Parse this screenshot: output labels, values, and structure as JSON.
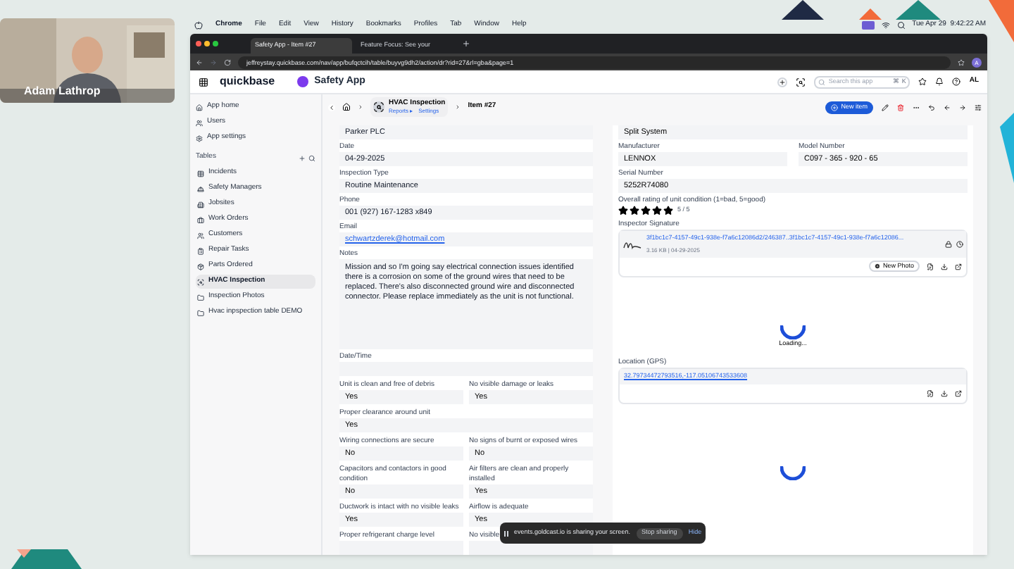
{
  "video_overlay": {
    "name": "Adam Lathrop"
  },
  "menu_bar": {
    "app": "Chrome",
    "items": [
      "File",
      "Edit",
      "View",
      "History",
      "Bookmarks",
      "Profiles",
      "Tab",
      "Window",
      "Help"
    ],
    "clock": "Tue Apr 29  9:42:22 AM"
  },
  "browser": {
    "tabs": [
      {
        "title": "Safety App - Item #27",
        "selected": true
      },
      {
        "title": "Feature Focus: See your",
        "selected": false
      }
    ],
    "url": "jeffreystay.quickbase.com/nav/app/bufqctcih/table/buyvg9dh2/action/dr?rid=27&rl=gba&page=1",
    "profile_initial": "A"
  },
  "app_header": {
    "logo": "quickbase",
    "app_name": "Safety App",
    "search": {
      "placeholder": "Search this app",
      "shortcut": "⌘ K"
    },
    "user_initials": "AL"
  },
  "sidebar": {
    "nav": [
      "App home",
      "Users",
      "App settings"
    ],
    "tables_heading": "Tables",
    "tables": [
      {
        "label": "Incidents",
        "selected": false
      },
      {
        "label": "Safety Managers",
        "selected": false
      },
      {
        "label": "Jobsites",
        "selected": false
      },
      {
        "label": "Work Orders",
        "selected": false
      },
      {
        "label": "Customers",
        "selected": false
      },
      {
        "label": "Repair Tasks",
        "selected": false
      },
      {
        "label": "Parts Ordered",
        "selected": false
      },
      {
        "label": "HVAC Inspection",
        "selected": true
      },
      {
        "label": "Inspection Photos",
        "selected": false
      },
      {
        "label": "Hvac inpspection table DEMO",
        "selected": false
      }
    ]
  },
  "breadcrumb": {
    "table": "HVAC Inspection",
    "links": [
      "Reports ▸",
      "Settings"
    ],
    "item": "Item #27",
    "new_button": "New item"
  },
  "left_fields": [
    {
      "kind": "text",
      "value": "Parker PLC"
    },
    {
      "kind": "text",
      "label": "Date",
      "value": "04-29-2025"
    },
    {
      "kind": "text",
      "label": "Inspection Type",
      "value": "Routine Maintenance"
    },
    {
      "kind": "text",
      "label": "Phone",
      "value": "001 (927) 167-1283 x849"
    },
    {
      "kind": "link",
      "label": "Email",
      "value": "schwartzderek@hotmail.com"
    },
    {
      "kind": "notes",
      "label": "Notes",
      "value": "Mission and so I'm going say electrical connection issues identified there is a corrosion on some of the ground wires that need to be replaced. There's also disconnected ground wire and disconnected connector. Please replace immediately as the unit is not functional."
    },
    {
      "kind": "text",
      "label": "Date/Time"
    }
  ],
  "checklist": [
    [
      {
        "label": "Unit is clean and free of debris",
        "value": "Yes"
      },
      {
        "label": "No visible damage or leaks",
        "value": "Yes"
      }
    ],
    [
      {
        "label": "Proper clearance around unit",
        "value": "Yes"
      }
    ],
    [
      {
        "label": "Wiring connections are secure",
        "value": "No"
      },
      {
        "label": "No signs of burnt or exposed wires",
        "value": "No"
      }
    ],
    [
      {
        "label": "Capacitors and contactors in good condition",
        "value": "No"
      },
      {
        "label": "Air filters are clean and properly installed",
        "value": "Yes"
      }
    ],
    [
      {
        "label": "Ductwork is intact with no visible leaks",
        "value": "Yes"
      },
      {
        "label": "Airflow is adequate",
        "value": "Yes"
      }
    ],
    [
      {
        "label": "Proper refrigerant charge level"
      },
      {
        "label": "No visible"
      }
    ]
  ],
  "right": {
    "system": "Split System",
    "manufacturer": {
      "label": "Manufacturer",
      "value": "LENNOX"
    },
    "model": {
      "label": "Model Number",
      "value": "C097 - 365 - 920 - 65"
    },
    "serial": {
      "label": "Serial Number",
      "value": "5252R74080"
    },
    "rating": {
      "label": "Overall rating of unit condition (1=bad, 5=good)",
      "stars": 5,
      "reading": "5 / 5"
    },
    "signature": {
      "label": "Inspector Signature",
      "file": "3f1bc1c7-4157-49c1-938e-f7a6c12086d2/246387..3f1bc1c7-4157-49c1-938e-f7a6c12086...",
      "meta": "3.16 KB | 04-29-2025",
      "button": "New Photo"
    },
    "loading": "Loading...",
    "location": {
      "label": "Location (GPS)",
      "value": "32.79734472793516,-117.05106743533608"
    }
  },
  "share_toast": {
    "message": "events.goldcast.io is sharing your screen.",
    "stop": "Stop sharing",
    "hide": "Hide"
  }
}
